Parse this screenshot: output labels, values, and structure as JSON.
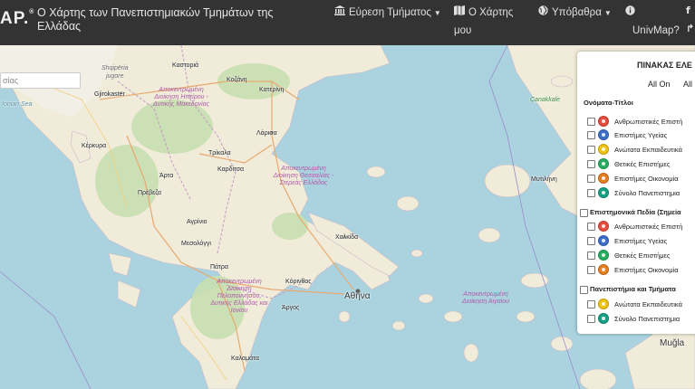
{
  "navbar": {
    "brand": "AP.",
    "title": "Ο Χάρτης των Πανεπιστημιακών Τμημάτων της Ελλάδας",
    "find_dept": "Εύρεση Τμήματος",
    "map_line1": "Ο Χάρτης",
    "map_line2": "μου",
    "basemap": "Υπόβαθρα",
    "info_text": "UnivMap?",
    "icons": {
      "find": "university-icon",
      "map": "map-icon",
      "basemap": "globe-icon",
      "info": "info-icon",
      "facebook": "facebook-icon"
    }
  },
  "search": {
    "value": "σίας"
  },
  "map": {
    "labels": {
      "kastoria": "Καστοριά",
      "shqiperia": "Shqipëria",
      "jugore": "jugore",
      "gjirokaster": "Gjirokastër",
      "kozani": "Κοζάνη",
      "katerini": "Κατερίνη",
      "larisa": "Λάρισα",
      "kerkyra": "Κέρκυρα",
      "trikala": "Τρίκαλα",
      "karditsa": "Καρδίτσα",
      "arta": "Άρτα",
      "preveza": "Πρέβεζα",
      "agrinio": "Αγρίνιο",
      "mesologgi": "Μεσολόγγι",
      "patra": "Πάτρα",
      "chalkida": "Χαλκίδα",
      "korinthos": "Κόρινθος",
      "athina": "Αθήνα",
      "argos": "Άργος",
      "kalamata": "Καλαμάτα",
      "mytilini": "Μυτιλήνη",
      "mugla": "Muğla",
      "canakkale": "Çanakkale",
      "adm_ipeiros": "Αποκεντρωμένη Διοίκηση Ηπείρου - Δυτικής Μακεδονίας",
      "adm_thessalia": "Αποκεντρωμένη Διοίκηση Θεσσαλίας - Στερεάς Ελλάδας",
      "adm_peloponnisos": "Αποκεντρωμένη Διοίκηση Πελοποννήσου, Δυτικής Ελλάδας και Ιονίου",
      "adm_aigaio": "Αποκεντρωμένη Διοίκηση Αιγαίου",
      "sea_ionian": "Ionian Sea"
    }
  },
  "panel": {
    "title": "ΠΙΝΑΚΑΣ ΕΛΕ",
    "all_on": "All On",
    "all_off": "All",
    "sections": [
      {
        "heading": "Ονόματα-Τίτλοι",
        "checkbox": false,
        "items": [
          {
            "label": "Ανθρωπιστικές Επιστή",
            "color": "#e74c3c"
          },
          {
            "label": "Επιστήμες Υγείας",
            "color": "#3b6fc9"
          },
          {
            "label": "Ανώτατα Εκπαιδευτικά",
            "color": "#f1c40f"
          },
          {
            "label": "Θετικές Επιστήμες",
            "color": "#27ae60"
          },
          {
            "label": "Επιστήμες Οικονομία",
            "color": "#e67e22"
          },
          {
            "label": "Σύνολο Πανεπιστημια",
            "color": "#16a085"
          }
        ]
      },
      {
        "heading": "Επιστημονικά Πεδία (Σημεία",
        "checkbox": true,
        "items": [
          {
            "label": "Ανθρωπιστικές Επιστή",
            "color": "#e74c3c"
          },
          {
            "label": "Επιστήμες Υγείας",
            "color": "#3b6fc9"
          },
          {
            "label": "Θετικές Επιστήμες",
            "color": "#27ae60"
          },
          {
            "label": "Επιστήμες Οικονομία",
            "color": "#e67e22"
          }
        ]
      },
      {
        "heading": "Πανεπιστήμια και Τμήματα",
        "checkbox": true,
        "items": [
          {
            "label": "Ανώτατα Εκπαιδευτικά",
            "color": "#f1c40f"
          },
          {
            "label": "Σύνολο Πανεπιστημια",
            "color": "#16a085"
          }
        ]
      }
    ]
  }
}
